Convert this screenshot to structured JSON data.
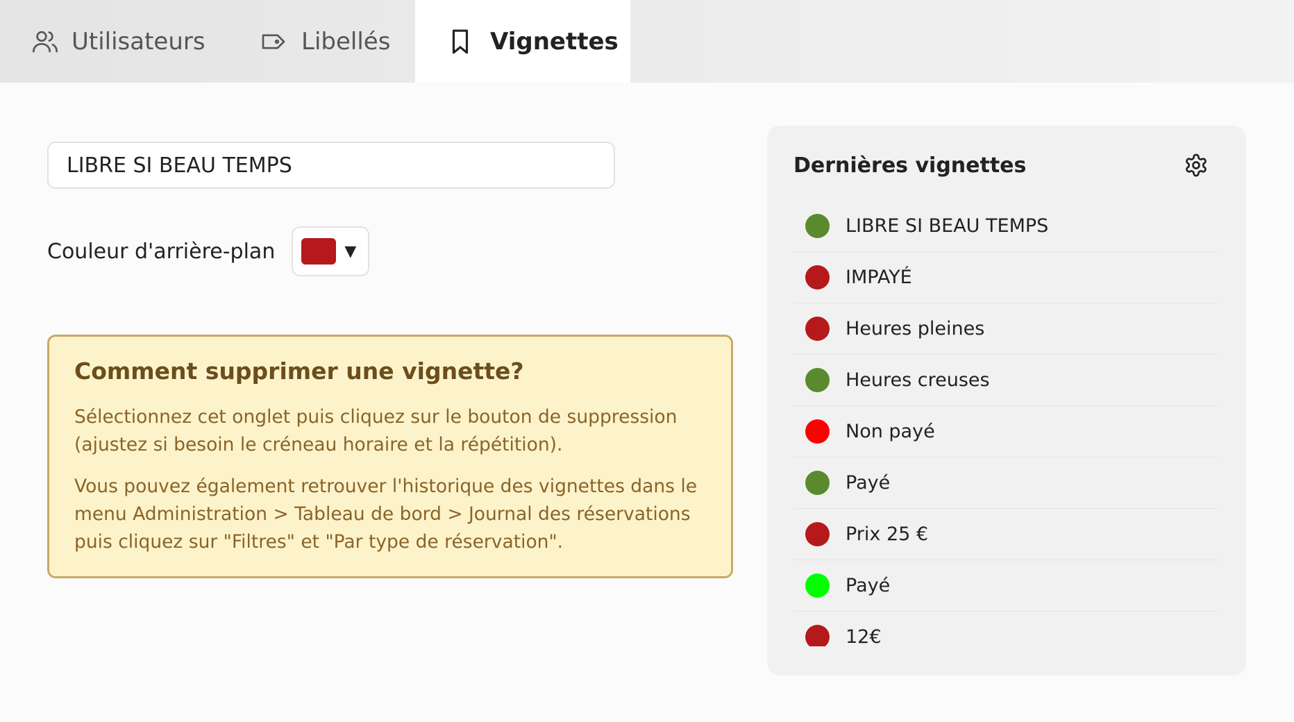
{
  "tabs": {
    "users": {
      "label": "Utilisateurs",
      "icon": "users-icon"
    },
    "labels": {
      "label": "Libellés",
      "icon": "tag-icon"
    },
    "vignettes": {
      "label": "Vignettes",
      "icon": "bookmark-icon",
      "active": true
    }
  },
  "form": {
    "name_value": "LIBRE SI BEAU TEMPS",
    "color_label": "Couleur d'arrière-plan",
    "selected_color": "#b5191c",
    "caret": "▼"
  },
  "info": {
    "title": "Comment supprimer une vignette?",
    "paragraph1": "Sélectionnez cet onglet puis cliquez sur le bouton de suppression (ajustez si besoin le créneau horaire et la répétition).",
    "paragraph2": "Vous pouvez également retrouver l'historique des vignettes dans le menu Administration > Tableau de bord > Journal des réservations puis cliquez sur \"Filtres\" et \"Par type de réservation\"."
  },
  "recent": {
    "title": "Dernières vignettes",
    "settings_icon": "gear-icon",
    "items": [
      {
        "label": "LIBRE SI BEAU TEMPS",
        "color": "#5a8a2e"
      },
      {
        "label": "IMPAYÉ",
        "color": "#b5191c"
      },
      {
        "label": "Heures pleines",
        "color": "#b5191c"
      },
      {
        "label": "Heures creuses",
        "color": "#5a8a2e"
      },
      {
        "label": "Non payé",
        "color": "#ff0000"
      },
      {
        "label": "Payé",
        "color": "#5a8a2e"
      },
      {
        "label": "Prix 25 €",
        "color": "#b5191c"
      },
      {
        "label": "Payé",
        "color": "#00ff00"
      },
      {
        "label": "12€",
        "color": "#b5191c"
      }
    ]
  }
}
